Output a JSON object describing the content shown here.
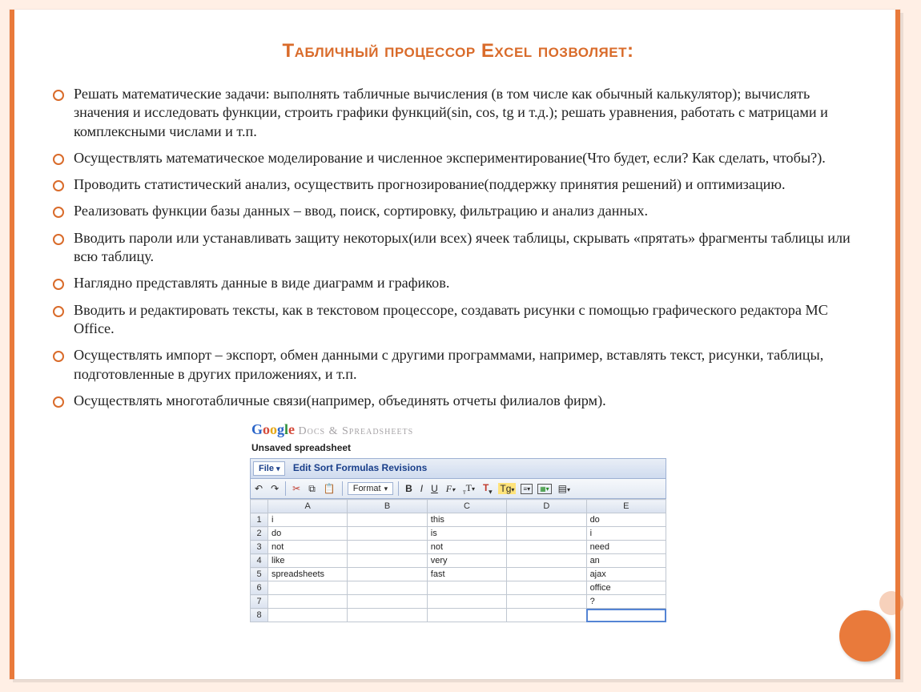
{
  "title": "Табличный процессор Excel позволяет:",
  "bullets": [
    "Решать математические задачи: выполнять табличные вычисления (в том числе как обычный калькулятор); вычислять значения и исследовать функции, строить графики функций(sin, cos, tg и т.д.); решать уравнения, работать с матрицами и комплексными числами и т.п.",
    "Осуществлять математическое моделирование и численное экспериментирование(Что будет, если? Как сделать, чтобы?).",
    "Проводить статистический анализ, осуществить прогнозирование(поддержку принятия решений) и оптимизацию.",
    "Реализовать функции базы данных – ввод, поиск, сортировку, фильтрацию и анализ данных.",
    "Вводить пароли или устанавливать защиту некоторых(или всех) ячеек таблицы, скрывать «прятать» фрагменты таблицы или всю таблицу.",
    "Наглядно представлять данные в виде диаграмм и графиков.",
    "Вводить и редактировать тексты, как в текстовом процессоре, создавать рисунки с помощью графического редактора MC Office.",
    "Осуществлять импорт – экспорт, обмен данными с другими программами, например, вставлять текст, рисунки, таблицы, подготовленные в других приложениях, и т.п.",
    "Осуществлять многотабличные связи(например, объединять отчеты филиалов фирм)."
  ],
  "sheet": {
    "brand_rest": " Docs & Spreadsheets",
    "doc_title": "Unsaved spreadsheet",
    "menu": {
      "file": "File",
      "edit": "Edit",
      "sort": "Sort",
      "formulas": "Formulas",
      "revisions": "Revisions"
    },
    "toolbar": {
      "undo": "↶",
      "redo": "↷",
      "cut": "✂",
      "format": "Format",
      "bold": "B",
      "italic": "I",
      "underline": "U"
    },
    "columns": [
      "",
      "A",
      "B",
      "C",
      "D",
      "E"
    ],
    "rows": [
      [
        "1",
        "i",
        "",
        "this",
        "",
        "do"
      ],
      [
        "2",
        "do",
        "",
        "is",
        "",
        "i"
      ],
      [
        "3",
        "not",
        "",
        "not",
        "",
        "need"
      ],
      [
        "4",
        "like",
        "",
        "very",
        "",
        "an"
      ],
      [
        "5",
        "spreadsheets",
        "",
        "fast",
        "",
        "ajax"
      ],
      [
        "6",
        "",
        "",
        "",
        "",
        "office"
      ],
      [
        "7",
        "",
        "",
        "",
        "",
        "?"
      ],
      [
        "8",
        "",
        "",
        "",
        "",
        ""
      ]
    ]
  }
}
